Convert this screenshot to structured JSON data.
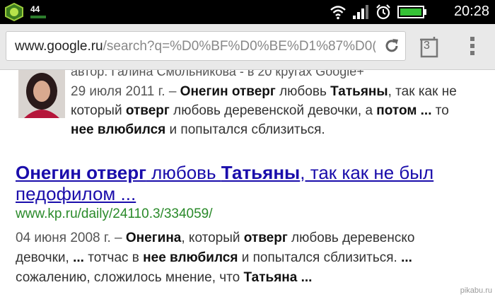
{
  "status_bar": {
    "notification_count": "44",
    "time": "20:28",
    "icons": [
      "app-shield-icon",
      "wifi-icon",
      "signal-icon",
      "alarm-icon",
      "battery-icon"
    ]
  },
  "browser": {
    "url_host": "www.google.ru",
    "url_rest": "/search?q=%D0%BF%D0%BE%D1%87%D0(",
    "tabs_count": "3",
    "icons": [
      "reload-icon",
      "tabs-icon",
      "overflow-menu-icon"
    ]
  },
  "results": {
    "first": {
      "byline": "автор: Галина Смольникова - в 20 кругах Google+",
      "date": "29 июля 2011 г. –",
      "snippet_l1": [
        "Онегин отверг",
        " любовь ",
        "Татьяны",
        ", так как не"
      ],
      "snippet_l2": [
        "который ",
        "отверг",
        " любовь деревенской девочки, а ",
        "потом ...",
        " то"
      ],
      "snippet_l3": [
        "нее влюбился",
        " и попытался сблизиться."
      ]
    },
    "second": {
      "title_l1": [
        "Онегин отверг",
        " любовь ",
        "Татьяны",
        ", так как не был"
      ],
      "title_l2": "педофилом ...",
      "url": "www.kp.ru/daily/24110.3/334059/",
      "date": "04 июня 2008 г. –",
      "snippet_l1": [
        "Онегина",
        ", который ",
        "отверг",
        " любовь деревенско"
      ],
      "snippet_l2": [
        "девочки, ",
        "...",
        " тотчас в ",
        "нее влюбился",
        " и попытался сблизиться. ",
        "..."
      ],
      "snippet_l3": [
        "сожалению, сложилось мнение, что ",
        "Татьяна ..."
      ]
    }
  },
  "watermark": "pikabu.ru",
  "colors": {
    "link": "#1a0dab",
    "url_green": "#2a8a2a",
    "status_bg": "#000000",
    "toolbar_bg": "#e9e9e9"
  }
}
